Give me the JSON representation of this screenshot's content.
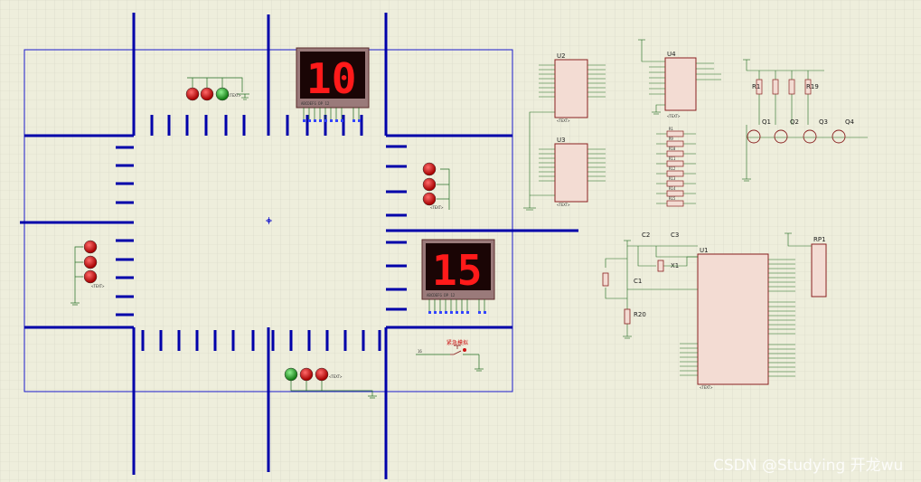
{
  "display_top": {
    "value": "10",
    "pins": "ABCDEFG DP 12"
  },
  "display_right": {
    "value": "15",
    "pins": "ABCDEFG DP 12"
  },
  "chips": {
    "u2": "U2",
    "u3": "U3",
    "u4": "U4",
    "u1": "U1",
    "rp1": "RP1",
    "q1": "Q1",
    "q2": "Q2",
    "q3": "Q3",
    "q4": "Q4",
    "r1": "R1",
    "r19": "R19",
    "r20": "R20",
    "c1": "C1",
    "c2": "C2",
    "c3": "C3",
    "x1": "X1"
  },
  "resistor_bank": [
    "R1",
    "R9",
    "R10",
    "R11",
    "R12",
    "R13",
    "R14",
    "R15"
  ],
  "emergency": {
    "label": "紧急模拟",
    "net": "16"
  },
  "text_placeholder": "<TEXT>",
  "watermark": "CSDN @Studying 开龙wu",
  "colors": {
    "bus": "#0000aa",
    "wire": "#1f6b1f",
    "chip_fill": "#f3dcd3",
    "chip_stroke": "#8a2020",
    "led_red": "#cc1111",
    "led_green": "#22aa22"
  }
}
